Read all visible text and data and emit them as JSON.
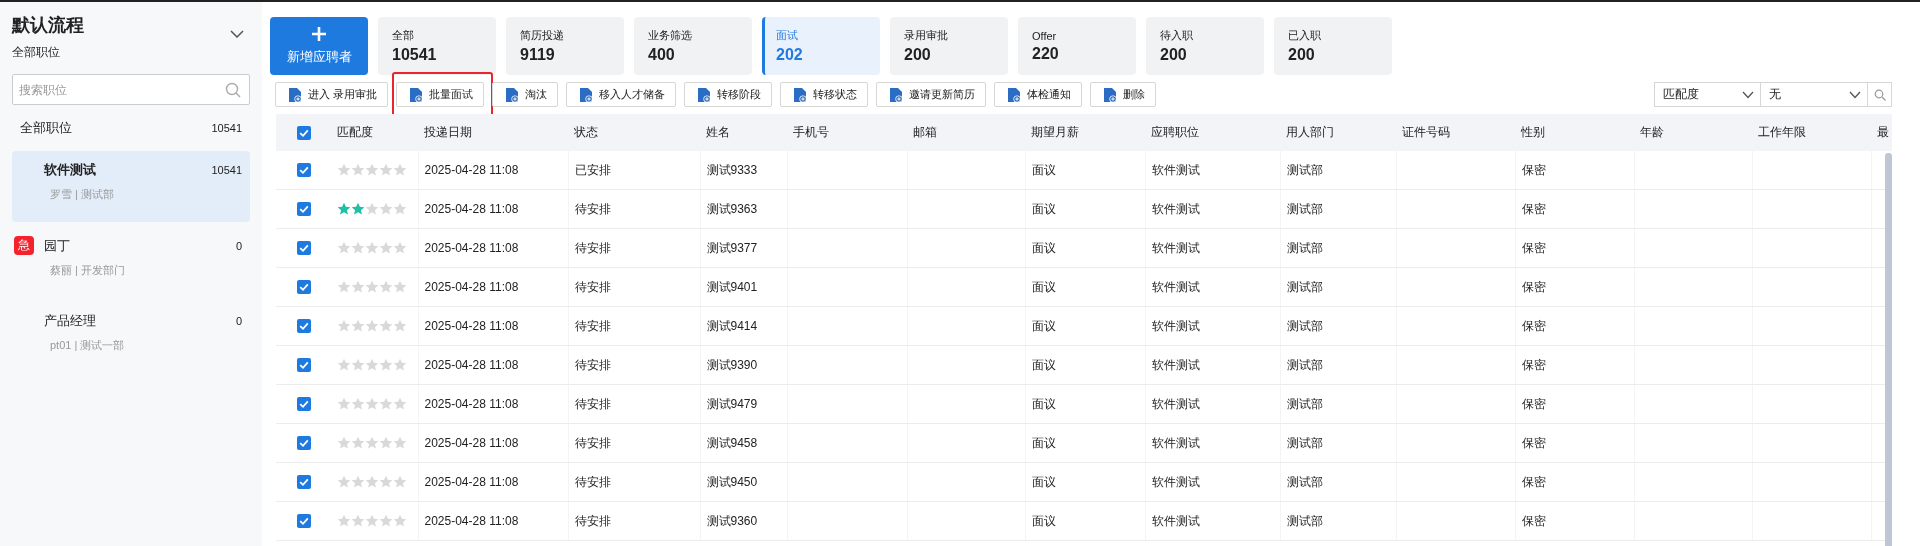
{
  "sidebar": {
    "title": "默认流程",
    "subtitle": "全部职位",
    "search": {
      "placeholder": "搜索职位"
    },
    "items": [
      {
        "name": "全部职位",
        "count": "10541",
        "selected": false
      },
      {
        "name": "软件测试",
        "count": "10541",
        "detail": "罗雪 | 测试部",
        "selected": true
      },
      {
        "name": "园丁",
        "count": "0",
        "detail": "蔡丽 | 开发部门",
        "badge": "急",
        "selected": false
      },
      {
        "name": "产品经理",
        "count": "0",
        "detail": "pt01 | 测试一部",
        "selected": false
      }
    ]
  },
  "add_button": {
    "label": "新增应聘者"
  },
  "stage_cards": [
    {
      "label": "全部",
      "value": "10541",
      "selected": false
    },
    {
      "label": "简历投递",
      "value": "9119",
      "selected": false
    },
    {
      "label": "业务筛选",
      "value": "400",
      "selected": false
    },
    {
      "label": "面试",
      "value": "202",
      "selected": true
    },
    {
      "label": "录用审批",
      "value": "200",
      "selected": false
    },
    {
      "label": "Offer",
      "value": "220",
      "selected": false
    },
    {
      "label": "待入职",
      "value": "200",
      "selected": false
    },
    {
      "label": "已入职",
      "value": "200",
      "selected": false
    }
  ],
  "toolbar": [
    {
      "label": "进入 录用审批",
      "highlighted": false
    },
    {
      "label": "批量面试",
      "highlighted": true
    },
    {
      "label": "淘汰",
      "highlighted": false
    },
    {
      "label": "移入人才储备",
      "highlighted": false
    },
    {
      "label": "转移阶段",
      "highlighted": false
    },
    {
      "label": "转移状态",
      "highlighted": false
    },
    {
      "label": "邀请更新简历",
      "highlighted": false
    },
    {
      "label": "体检通知",
      "highlighted": false
    },
    {
      "label": "删除",
      "highlighted": false
    }
  ],
  "filter": {
    "field": "匹配度",
    "value": "无"
  },
  "table": {
    "all_checked": true,
    "columns": [
      "匹配度",
      "投递日期",
      "状态",
      "姓名",
      "手机号",
      "邮箱",
      "期望月薪",
      "应聘职位",
      "用人部门",
      "证件号码",
      "性别",
      "年龄",
      "工作年限",
      "最"
    ],
    "rows": [
      {
        "checked": true,
        "stars": 0,
        "date": "2025-04-28 11:08",
        "status": "已安排",
        "name": "测试9333",
        "salary": "面议",
        "position": "软件测试",
        "department": "测试部",
        "gender": "保密"
      },
      {
        "checked": true,
        "stars": 2,
        "date": "2025-04-28 11:08",
        "status": "待安排",
        "name": "测试9363",
        "salary": "面议",
        "position": "软件测试",
        "department": "测试部",
        "gender": "保密"
      },
      {
        "checked": true,
        "stars": 0,
        "date": "2025-04-28 11:08",
        "status": "待安排",
        "name": "测试9377",
        "salary": "面议",
        "position": "软件测试",
        "department": "测试部",
        "gender": "保密"
      },
      {
        "checked": true,
        "stars": 0,
        "date": "2025-04-28 11:08",
        "status": "待安排",
        "name": "测试9401",
        "salary": "面议",
        "position": "软件测试",
        "department": "测试部",
        "gender": "保密"
      },
      {
        "checked": true,
        "stars": 0,
        "date": "2025-04-28 11:08",
        "status": "待安排",
        "name": "测试9414",
        "salary": "面议",
        "position": "软件测试",
        "department": "测试部",
        "gender": "保密"
      },
      {
        "checked": true,
        "stars": 0,
        "date": "2025-04-28 11:08",
        "status": "待安排",
        "name": "测试9390",
        "salary": "面议",
        "position": "软件测试",
        "department": "测试部",
        "gender": "保密"
      },
      {
        "checked": true,
        "stars": 0,
        "date": "2025-04-28 11:08",
        "status": "待安排",
        "name": "测试9479",
        "salary": "面议",
        "position": "软件测试",
        "department": "测试部",
        "gender": "保密"
      },
      {
        "checked": true,
        "stars": 0,
        "date": "2025-04-28 11:08",
        "status": "待安排",
        "name": "测试9458",
        "salary": "面议",
        "position": "软件测试",
        "department": "测试部",
        "gender": "保密"
      },
      {
        "checked": true,
        "stars": 0,
        "date": "2025-04-28 11:08",
        "status": "待安排",
        "name": "测试9450",
        "salary": "面议",
        "position": "软件测试",
        "department": "测试部",
        "gender": "保密"
      },
      {
        "checked": true,
        "stars": 0,
        "date": "2025-04-28 11:08",
        "status": "待安排",
        "name": "测试9360",
        "salary": "面议",
        "position": "软件测试",
        "department": "测试部",
        "gender": "保密"
      }
    ]
  }
}
